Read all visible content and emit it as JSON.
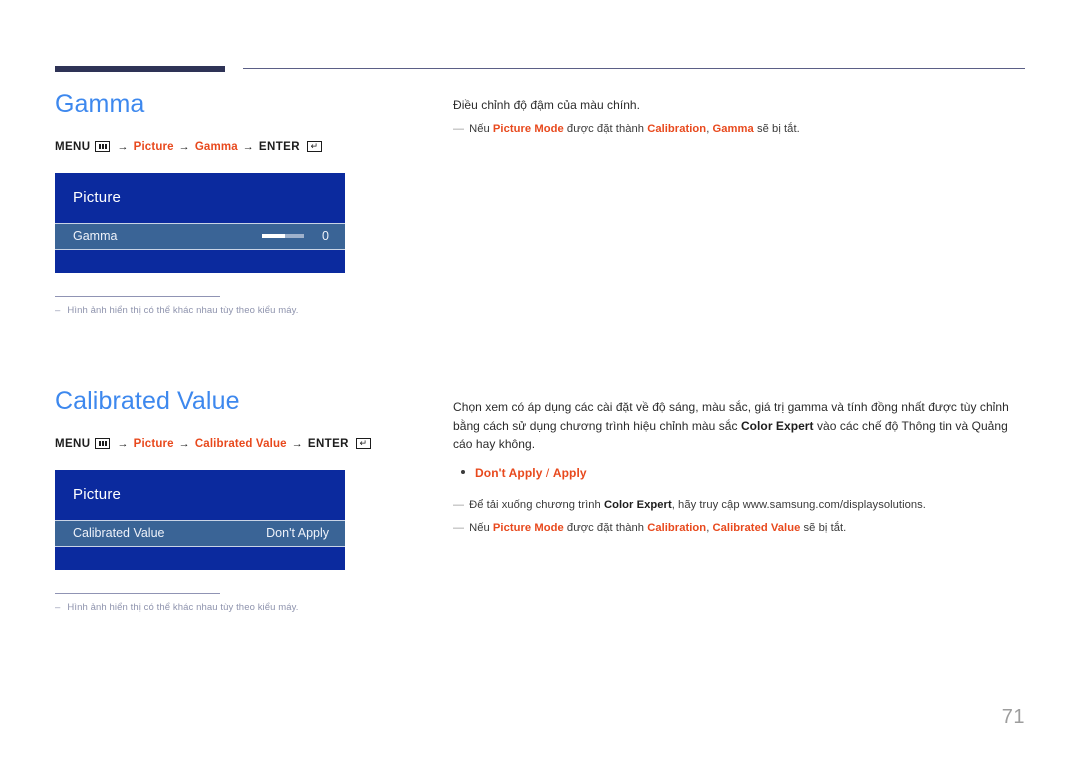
{
  "header": {
    "rule_color": "#2e3356"
  },
  "page_number": "71",
  "sections": [
    {
      "title": "Gamma",
      "menu_path": {
        "menu_label": "MENU",
        "menu_icon": "menu-bars-icon",
        "arrow": "→",
        "step1": "Picture",
        "step2": "Gamma",
        "enter_label": "ENTER",
        "enter_icon": "enter-return-icon"
      },
      "osd": {
        "title": "Picture",
        "row_label": "Gamma",
        "row_value": "0",
        "slider_percent": 55,
        "has_slider": true
      },
      "note": {
        "dash": "‒",
        "text": "Hình ảnh hiển thị có thể khác nhau tùy theo kiểu máy."
      },
      "right": {
        "intro": "Điều chỉnh độ đậm của màu chính.",
        "notes": [
          {
            "dash": "—",
            "parts": [
              {
                "t": "Nếu ",
                "s": "normal"
              },
              {
                "t": "Picture Mode",
                "s": "hl"
              },
              {
                "t": " được đặt thành ",
                "s": "normal"
              },
              {
                "t": "Calibration",
                "s": "hl"
              },
              {
                "t": ", ",
                "s": "normal"
              },
              {
                "t": "Gamma",
                "s": "hl"
              },
              {
                "t": " sẽ bị tắt.",
                "s": "normal"
              }
            ]
          }
        ]
      }
    },
    {
      "title": "Calibrated Value",
      "menu_path": {
        "menu_label": "MENU",
        "menu_icon": "menu-bars-icon",
        "arrow": "→",
        "step1": "Picture",
        "step2": "Calibrated Value",
        "enter_label": "ENTER",
        "enter_icon": "enter-return-icon"
      },
      "osd": {
        "title": "Picture",
        "row_label": "Calibrated Value",
        "row_value": "Don't Apply",
        "slider_percent": 0,
        "has_slider": false
      },
      "note": {
        "dash": "‒",
        "text": "Hình ảnh hiển thị có thể khác nhau tùy theo kiểu máy."
      },
      "right": {
        "intro_parts": [
          {
            "t": "Chọn xem có áp dụng các cài đặt về độ sáng, màu sắc, giá trị gamma và tính đồng nhất được tùy chỉnh bằng cách sử dụng chương trình hiệu chỉnh màu sắc ",
            "s": "normal"
          },
          {
            "t": "Color Expert",
            "s": "bold"
          },
          {
            "t": " vào các chế độ Thông tin và Quảng cáo hay không.",
            "s": "normal"
          }
        ],
        "bullet": {
          "option1": "Don't Apply",
          "separator": " / ",
          "option2": "Apply"
        },
        "notes": [
          {
            "dash": "—",
            "parts": [
              {
                "t": "Để tải xuống chương trình ",
                "s": "normal"
              },
              {
                "t": "Color Expert",
                "s": "bold"
              },
              {
                "t": ", hãy truy cập www.samsung.com/displaysolutions.",
                "s": "normal"
              }
            ]
          },
          {
            "dash": "—",
            "parts": [
              {
                "t": "Nếu ",
                "s": "normal"
              },
              {
                "t": "Picture Mode",
                "s": "hl"
              },
              {
                "t": " được đặt thành ",
                "s": "normal"
              },
              {
                "t": "Calibration",
                "s": "hl"
              },
              {
                "t": ", ",
                "s": "normal"
              },
              {
                "t": "Calibrated Value",
                "s": "hl"
              },
              {
                "t": " sẽ bị tắt.",
                "s": "normal"
              }
            ]
          }
        ]
      }
    }
  ]
}
